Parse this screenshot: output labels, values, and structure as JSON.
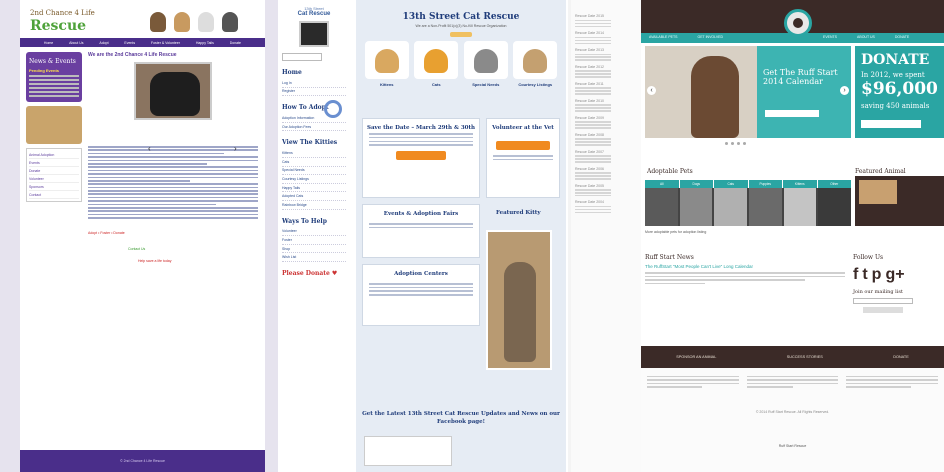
{
  "panel1": {
    "logo_line1": "2nd Chance 4 Life",
    "logo_line2": "Rescue",
    "nav": [
      "Home",
      "About Us",
      "Adopt",
      "Events",
      "Foster & Volunteer",
      "Happy Tails",
      "Donate"
    ],
    "sidebar_title": "News & Events",
    "sidebar_sub": "Pending Events",
    "main_title": "We are the 2nd Chance 4 Life Rescue",
    "foot_text": "© 2nd Chance 4 Life Rescue",
    "pet_colors": [
      "#7a5a3a",
      "#c89a60",
      "#ddd",
      "#555"
    ]
  },
  "panel2": {
    "logo_small": "13th Street",
    "logo_big": "Cat Rescue",
    "side_sections": [
      "Home",
      "How To Adopt",
      "View The Kitties",
      "Ways To Help",
      "Please Donate ♥"
    ],
    "home_items": [
      "Log In",
      "Register"
    ],
    "adopt_items": [
      "Adoption Information",
      "Our Adoption Fees"
    ],
    "kitties_items": [
      "Kittens",
      "Cats",
      "Special Needs",
      "Courtesy Listings",
      "Happy Tails",
      "Adopted Cats",
      "Rainbow Bridge"
    ],
    "help_items": [
      "Volunteer",
      "Foster",
      "Shop",
      "Wish List"
    ],
    "site_title": "13th Street Cat Rescue",
    "site_sub": "We are a Non-Profit 501(c)(3) No-Kill Rescue Organization",
    "categories": [
      "Kittens",
      "Cats",
      "Special Needs",
      "Courtesy Listings"
    ],
    "cat_colors": [
      "#d9a860",
      "#e8a030",
      "#8a8a8a",
      "#c4a070"
    ],
    "box1_title": "Save the Date – March 29th & 30th",
    "box2_title": "Volunteer at the Vet",
    "box3_title": "Events & Adoption Fairs",
    "box4_title": "Featured Kitty",
    "box5_title": "Adoption Centers",
    "latest": "Get the Latest 13th Street Cat Rescue Updates and News on our Facebook page!"
  },
  "panel3": {
    "items": [
      "Rescue Date 2015",
      "Rescue Date 2014",
      "Rescue Date 2013",
      "Rescue Date 2012",
      "Rescue Date 2011",
      "Rescue Date 2010",
      "Rescue Date 2009",
      "Rescue Date 2008",
      "Rescue Date 2007",
      "Rescue Date 2006",
      "Rescue Date 2005",
      "Rescue Date 2004"
    ]
  },
  "panel4": {
    "nav": [
      "AVAILABLE PETS",
      "GET INVOLVED",
      "EVENTS",
      "ABOUT US",
      "DONATE"
    ],
    "hero_caption": "Get The Ruff Start 2014 Calendar",
    "donate_title": "DONATE",
    "donate_sub": "In 2012, we spent",
    "donate_amount": "$96,000",
    "donate_small": "saving 450 animals",
    "adoptable_title": "Adoptable Pets",
    "featured_title": "Featured Animal",
    "tabs": [
      "All",
      "Dogs",
      "Cats",
      "Puppies",
      "Kittens",
      "Other"
    ],
    "pet_colors": [
      "#5a5a5a",
      "#8a8a8a",
      "#b0b0b0",
      "#6a6a6a",
      "#c4c4c4",
      "#3a3a3a"
    ],
    "note": "More adoptable pets for adoption listing",
    "news_title": "Ruff Start News",
    "news_link": "The RuffStart \"Most People Can't Live\" Long Calendar",
    "follow_title": "Follow Us",
    "social": [
      "f",
      "t",
      "p",
      "g+"
    ],
    "mailing": "Join our mailing list",
    "band": [
      "SPONSOR AN ANIMAL",
      "SUCCESS STORIES",
      "DONATE"
    ],
    "copyright": "© 2014 Ruff Start Rescue. All Rights Reserved.",
    "end": "Ruff Start Rescue"
  }
}
